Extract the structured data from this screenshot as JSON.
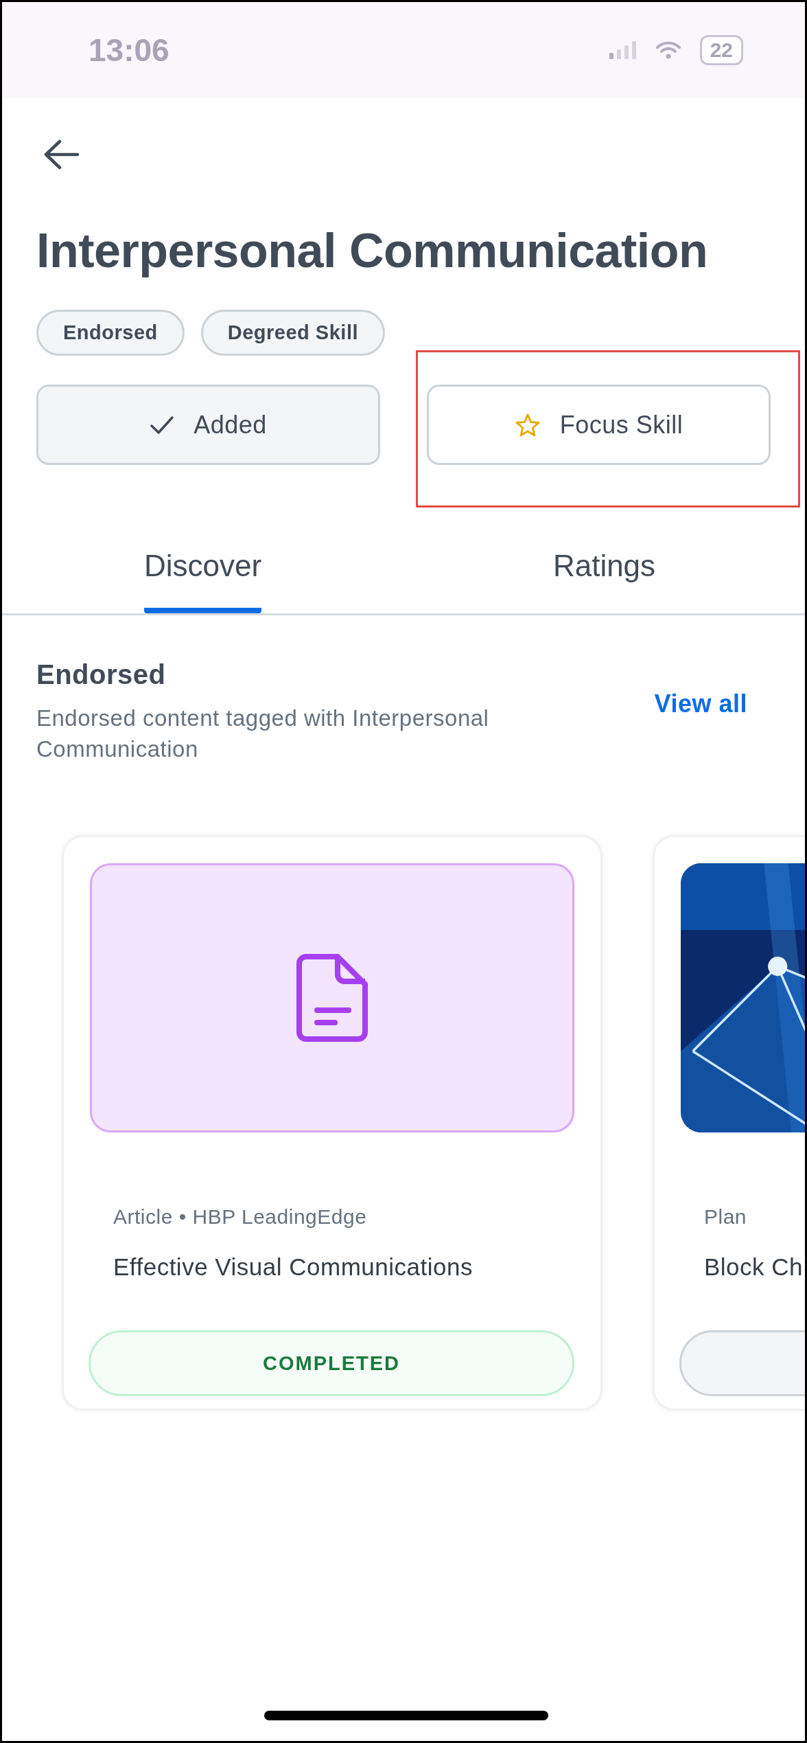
{
  "status_bar": {
    "time": "13:06",
    "battery": "22"
  },
  "title": "Interpersonal Communication",
  "tags": [
    "Endorsed",
    "Degreed Skill"
  ],
  "actions": [
    {
      "kind": "added",
      "label": "Added",
      "highlighted": false
    },
    {
      "kind": "focus",
      "label": "Focus Skill",
      "highlighted": true
    }
  ],
  "tabs": [
    {
      "label": "Discover",
      "selected": true
    },
    {
      "label": "Ratings",
      "selected": false
    }
  ],
  "section": {
    "title": "Endorsed",
    "subtitle": "Endorsed content tagged with Interpersonal Communication",
    "link": "View all"
  },
  "cards": [
    {
      "kind": "article",
      "meta": "Article • HBP LeadingEdge",
      "title": "Effective Visual Communications",
      "completed": true,
      "button": "COMPLETED"
    },
    {
      "kind": "picture",
      "meta": "Plan",
      "title": "Block Ch",
      "completed": false
    }
  ]
}
